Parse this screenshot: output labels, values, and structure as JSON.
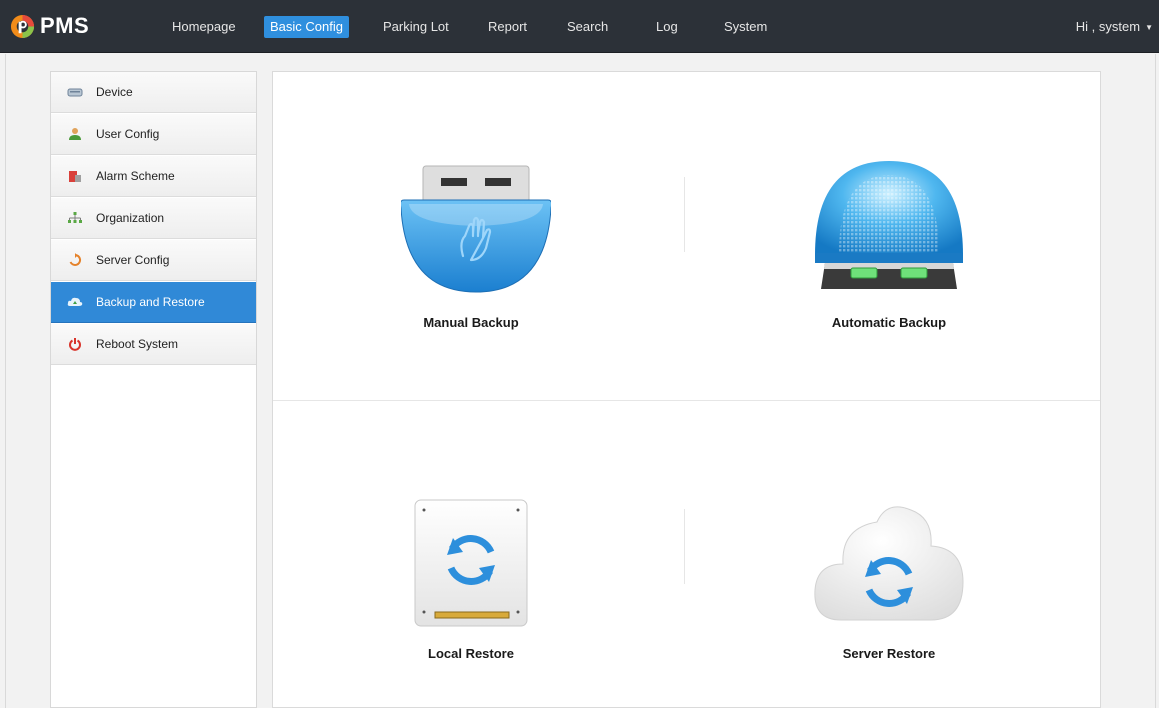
{
  "app": {
    "logo_text": "PMS"
  },
  "nav": {
    "items": [
      {
        "label": "Homepage"
      },
      {
        "label": "Basic Config",
        "active": true
      },
      {
        "label": "Parking Lot"
      },
      {
        "label": "Report"
      },
      {
        "label": "Search"
      },
      {
        "label": "Log"
      },
      {
        "label": "System"
      }
    ],
    "user_greeting": "Hi , system",
    "user_caret": "▼"
  },
  "sidebar": {
    "items": [
      {
        "label": "Device",
        "icon": "device-icon"
      },
      {
        "label": "User Config",
        "icon": "user-icon"
      },
      {
        "label": "Alarm Scheme",
        "icon": "alarm-icon"
      },
      {
        "label": "Organization",
        "icon": "organization-icon"
      },
      {
        "label": "Server Config",
        "icon": "server-config-icon"
      },
      {
        "label": "Backup and Restore",
        "icon": "backup-restore-icon",
        "active": true
      },
      {
        "label": "Reboot System",
        "icon": "power-icon"
      }
    ]
  },
  "main": {
    "tiles": [
      {
        "label": "Manual Backup",
        "icon": "manual-backup-icon"
      },
      {
        "label": "Automatic Backup",
        "icon": "automatic-backup-icon"
      },
      {
        "label": "Local Restore",
        "icon": "local-restore-icon"
      },
      {
        "label": "Server Restore",
        "icon": "server-restore-icon"
      }
    ]
  },
  "colors": {
    "topbar": "#2c3138",
    "accent": "#2f8fde",
    "sidebar_active": "#3089d7"
  }
}
